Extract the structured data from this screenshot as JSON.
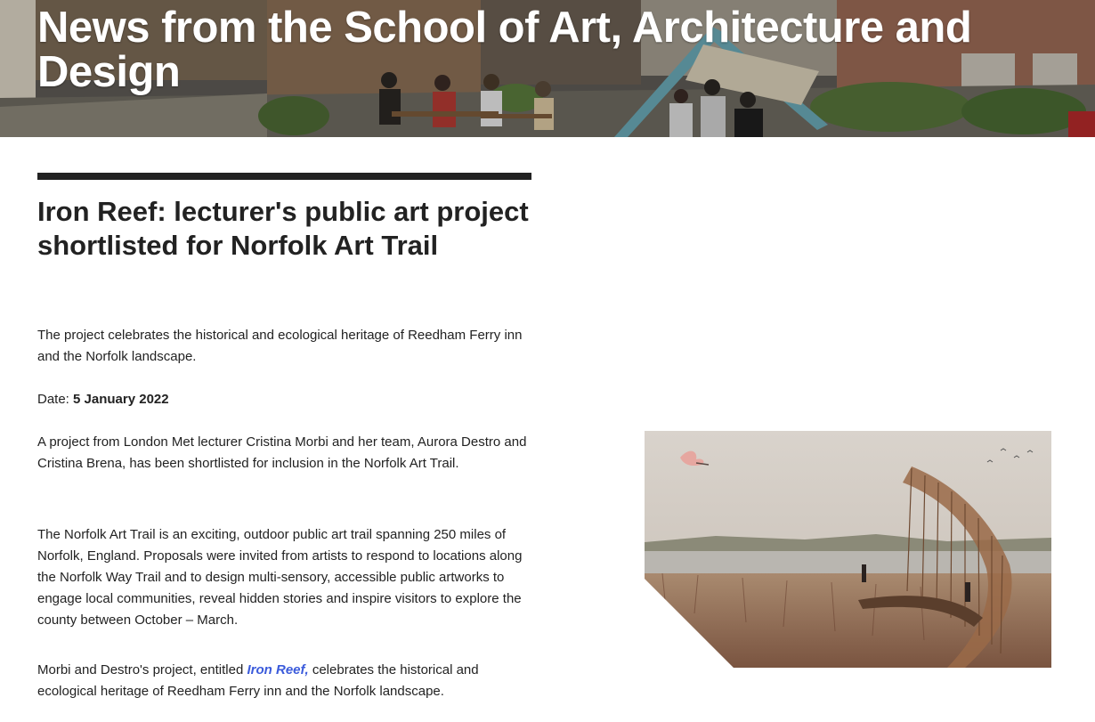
{
  "hero": {
    "title": "News from the School of Art, Architecture and Design"
  },
  "article": {
    "title": "Iron Reef: lecturer's public art project shortlisted for Norfolk Art Trail",
    "summary": "The project celebrates the historical and ecological heritage of Reedham Ferry inn and the Norfolk landscape.",
    "date_label": "Date:",
    "date_value": "5 January 2022",
    "para1": "A project from London Met lecturer Cristina Morbi and her team, Aurora Destro and Cristina Brena, has been shortlisted for inclusion in the Norfolk Art Trail.",
    "para2": "The Norfolk Art Trail is an exciting, outdoor public art trail spanning 250 miles of Norfolk, England. Proposals were invited from artists to respond to locations along the Norfolk Way Trail and to design multi-sensory, accessible public artworks to engage local communities, reveal hidden stories and inspire visitors to explore the county between October – March.",
    "para3_before": "Morbi and Destro's project, entitled ",
    "para3_link": "Iron Reef,",
    "para3_after": " celebrates the historical and ecological heritage of Reedham Ferry inn and the Norfolk landscape."
  },
  "colors": {
    "link": "#3b5bdb",
    "text": "#222222",
    "rule": "#222222"
  }
}
